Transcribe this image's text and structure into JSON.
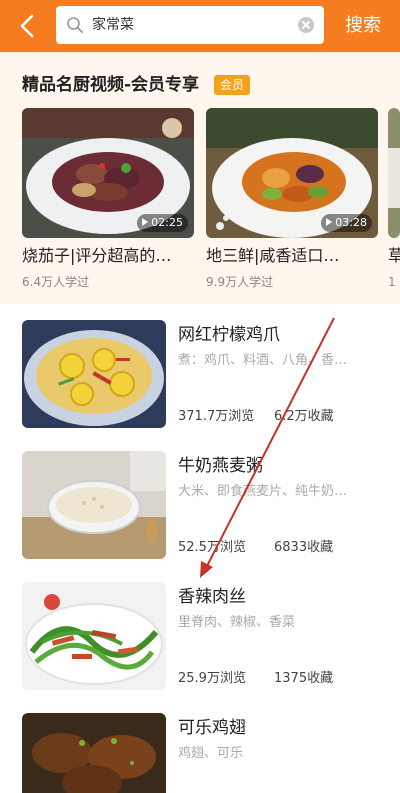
{
  "header": {
    "search_value": "家常菜",
    "search_button": "搜索"
  },
  "premium": {
    "title": "精品名厨视频-会员专享",
    "badge": "会员",
    "cards": [
      {
        "title": "烧茄子|评分超高的…",
        "learners": "6.4万人学过",
        "duration": "02:25"
      },
      {
        "title": "地三鲜|咸香适口…",
        "learners": "9.9万人学过",
        "duration": "03:28"
      },
      {
        "title": "草",
        "learners": "1",
        "duration": ""
      }
    ]
  },
  "recipes": [
    {
      "name": "网红柠檬鸡爪",
      "ingredients": "煮：鸡爪、料酒、八角、香…",
      "views": "371.7万浏览",
      "favorites": "6.2万收藏"
    },
    {
      "name": "牛奶燕麦粥",
      "ingredients": "大米、即食燕麦片、纯牛奶…",
      "views": "52.5万浏览",
      "favorites": "6833收藏"
    },
    {
      "name": "香辣肉丝",
      "ingredients": "里脊肉、辣椒、香菜",
      "views": "25.9万浏览",
      "favorites": "1375收藏"
    },
    {
      "name": "可乐鸡翅",
      "ingredients": "鸡翅、可乐",
      "views": "",
      "favorites": ""
    }
  ],
  "colors": {
    "brand_orange": "#f57d1f",
    "vip_badge": "#f4a21b",
    "arrow_red": "#c8322d"
  }
}
